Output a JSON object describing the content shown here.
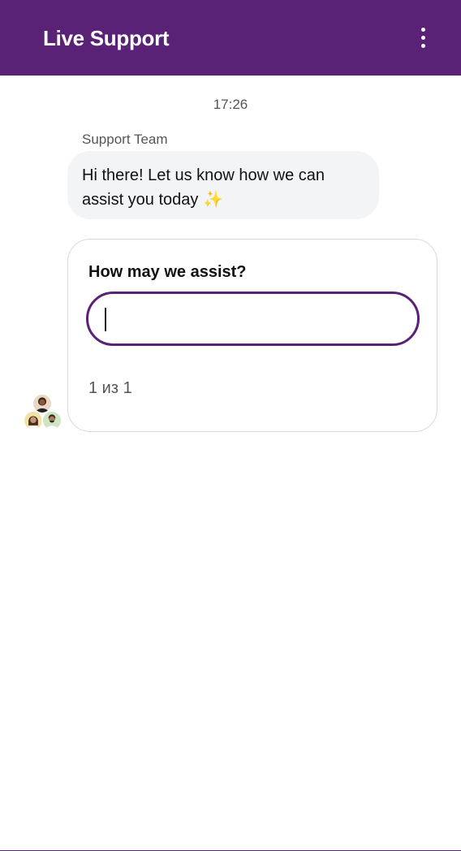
{
  "header": {
    "title": "Live Support",
    "menu_icon": "more-vertical-icon"
  },
  "chat": {
    "timestamp": "17:26",
    "sender": "Support Team",
    "message": "Hi there! Let us know how we can assist you today",
    "message_emoji": "✨"
  },
  "form": {
    "label": "How may we assist?",
    "input_value": "",
    "pager": "1 из 1"
  },
  "avatars": [
    "agent-avatar-1",
    "agent-avatar-2",
    "agent-avatar-3"
  ],
  "colors": {
    "brand": "#5a2277",
    "bubble": "#f3f4f6",
    "card_border": "#d9d9d9"
  }
}
